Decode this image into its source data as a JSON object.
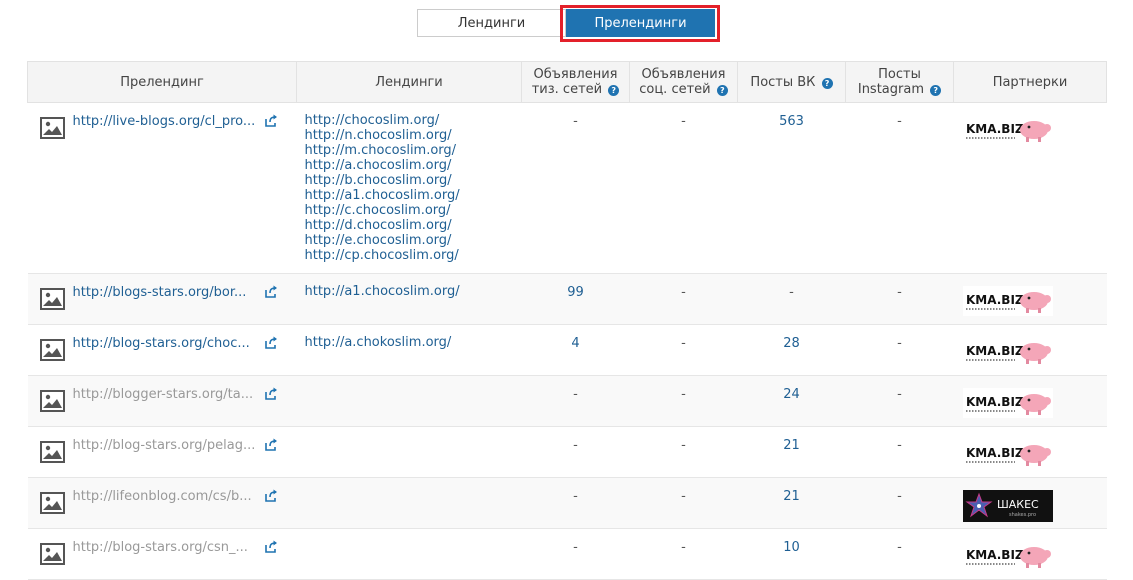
{
  "tabs": {
    "landings": "Лендинги",
    "prelandings": "Прелендинги"
  },
  "headers": {
    "prelanding": "Прелендинг",
    "landings": "Лендинги",
    "teaser_ads_line1": "Объявления",
    "teaser_ads_line2": "тиз. сетей",
    "social_ads_line1": "Объявления",
    "social_ads_line2": "соц. сетей",
    "vk_posts": "Посты ВК",
    "instagram_line1": "Посты",
    "instagram_line2": "Instagram",
    "partners": "Партнерки",
    "help_glyph": "?"
  },
  "rows": [
    {
      "prelanding": "http://live-blogs.org/cl_pro...",
      "landings": [
        "http://chocoslim.org/",
        "http://n.chocoslim.org/",
        "http://m.chocoslim.org/",
        "http://a.chocoslim.org/",
        "http://b.chocoslim.org/",
        "http://a1.chocoslim.org/",
        "http://c.chocoslim.org/",
        "http://d.chocoslim.org/",
        "http://e.chocoslim.org/",
        "http://cp.chocoslim.org/"
      ],
      "teaser": "-",
      "social": "-",
      "vk": "563",
      "instagram": "-",
      "partner": "KMA.BIZ",
      "active": true
    },
    {
      "prelanding": "http://blogs-stars.org/bor...",
      "landings": [
        "http://a1.chocoslim.org/"
      ],
      "teaser": "99",
      "social": "-",
      "vk": "-",
      "instagram": "-",
      "partner": "KMA.BIZ",
      "active": true
    },
    {
      "prelanding": "http://blog-stars.org/choc...",
      "landings": [
        "http://a.chokoslim.org/"
      ],
      "teaser": "4",
      "social": "-",
      "vk": "28",
      "instagram": "-",
      "partner": "KMA.BIZ",
      "active": true
    },
    {
      "prelanding": "http://blogger-stars.org/ta...",
      "landings": [],
      "teaser": "-",
      "social": "-",
      "vk": "24",
      "instagram": "-",
      "partner": "KMA.BIZ",
      "active": false
    },
    {
      "prelanding": "http://blog-stars.org/pelag...",
      "landings": [],
      "teaser": "-",
      "social": "-",
      "vk": "21",
      "instagram": "-",
      "partner": "KMA.BIZ",
      "active": false
    },
    {
      "prelanding": "http://lifeonblog.com/cs/b...",
      "landings": [],
      "teaser": "-",
      "social": "-",
      "vk": "21",
      "instagram": "-",
      "partner": "ШАКЕС",
      "partner_sub": "shakes.pro",
      "active": false
    },
    {
      "prelanding": "http://blog-stars.org/csn_...",
      "landings": [],
      "teaser": "-",
      "social": "-",
      "vk": "10",
      "instagram": "-",
      "partner": "KMA.BIZ",
      "active": false
    }
  ],
  "colors": {
    "accent": "#1f73b1",
    "highlight": "#e3202a",
    "link": "#1f5f93",
    "muted_link": "#999999"
  }
}
